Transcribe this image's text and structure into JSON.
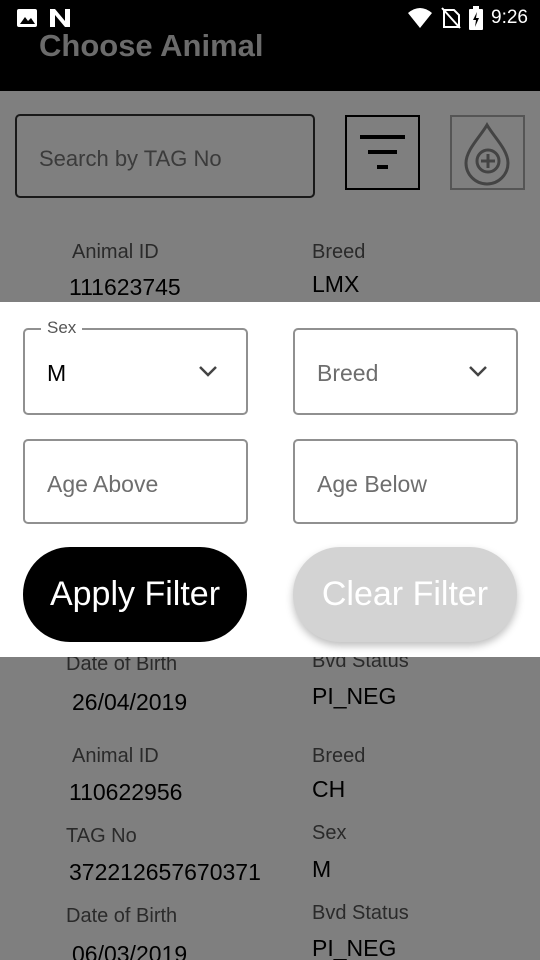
{
  "status_bar": {
    "time": "9:26",
    "left_icons": [
      "image-icon",
      "n-logo-icon"
    ],
    "right_icons": [
      "wifi-icon",
      "no-sim-icon",
      "battery-charging-icon"
    ]
  },
  "app": {
    "title": "Choose Animal"
  },
  "search": {
    "placeholder": "Search by TAG No"
  },
  "toolbar_icons": {
    "filter": "filter-icon",
    "add": "blood-drop-add-icon"
  },
  "animals": [
    {
      "animal_id_label": "Animal ID",
      "animal_id": "111623745",
      "breed_label": "Breed",
      "breed": "LMX",
      "dob_label": "Date of Birth",
      "dob": "26/04/2019",
      "bvd_label": "Bvd Status",
      "bvd": "PI_NEG"
    },
    {
      "animal_id_label": "Animal ID",
      "animal_id": "110622956",
      "breed_label": "Breed",
      "breed": "CH",
      "tag_label": "TAG No",
      "tag": "372212657670371",
      "sex_label": "Sex",
      "sex": "M",
      "dob_label": "Date of Birth",
      "dob": "06/03/2019",
      "bvd_label": "Bvd Status",
      "bvd": "PI_NEG"
    }
  ],
  "filter": {
    "sex_label": "Sex",
    "sex_value": "M",
    "breed_placeholder": "Breed",
    "age_above_placeholder": "Age Above",
    "age_below_placeholder": "Age Below",
    "apply_label": "Apply Filter",
    "clear_label": "Clear Filter"
  }
}
